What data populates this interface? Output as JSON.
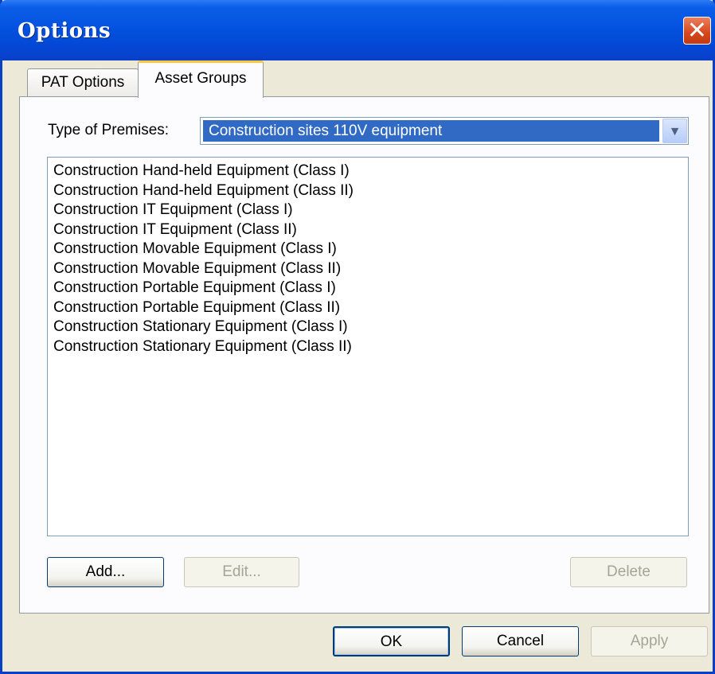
{
  "window": {
    "title": "Options",
    "close_glyph": "✕"
  },
  "tabs": [
    {
      "label": "PAT Options",
      "selected": false
    },
    {
      "label": "Asset Groups",
      "selected": true
    }
  ],
  "premises": {
    "label": "Type of Premises:",
    "selected_value": "Construction sites 110V equipment",
    "dropdown_icon": "chevron-down-icon"
  },
  "asset_groups": [
    "Construction Hand-held Equipment (Class I)",
    "Construction Hand-held Equipment (Class II)",
    "Construction IT Equipment (Class I)",
    "Construction IT Equipment (Class II)",
    "Construction Movable Equipment (Class I)",
    "Construction Movable Equipment (Class II)",
    "Construction Portable Equipment (Class I)",
    "Construction Portable Equipment (Class II)",
    "Construction Stationary Equipment (Class I)",
    "Construction Stationary Equipment (Class II)"
  ],
  "group_buttons": {
    "add": "Add...",
    "edit": "Edit...",
    "delete": "Delete"
  },
  "dialog_buttons": {
    "ok": "OK",
    "cancel": "Cancel",
    "apply": "Apply"
  },
  "colors": {
    "titlebar": "#0552e0",
    "selection": "#316ac5",
    "dialog_bg": "#ece9d8",
    "close": "#d8461b"
  }
}
